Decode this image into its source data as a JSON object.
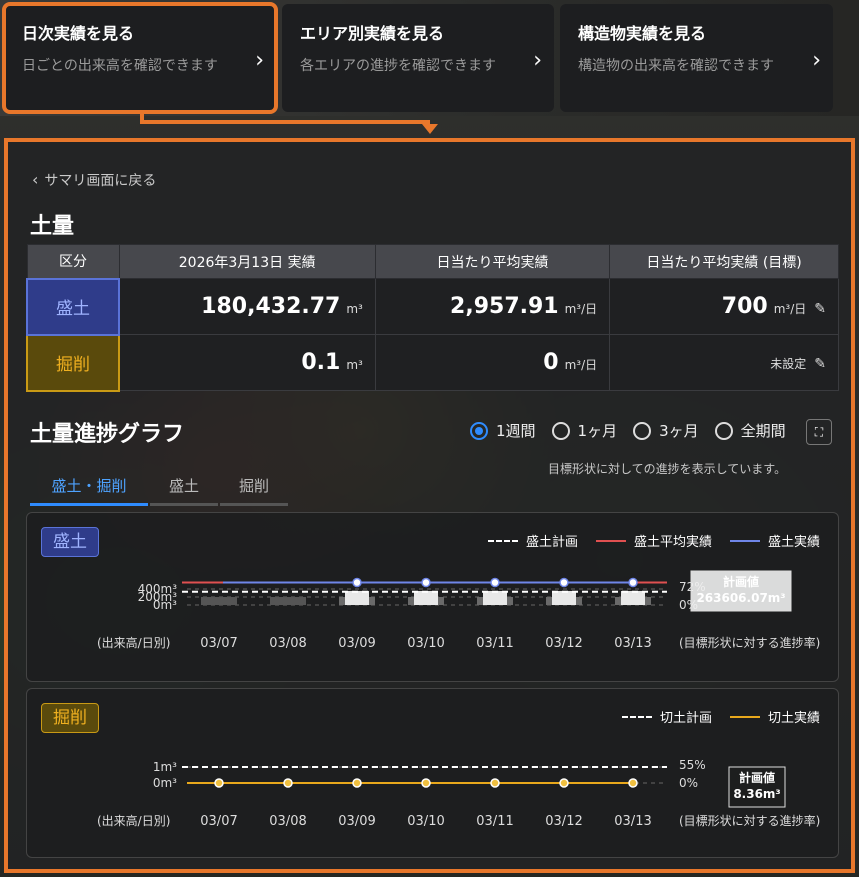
{
  "nav": [
    {
      "title": "日次実績を見る",
      "desc": "日ごとの出来高を確認できます",
      "active": true
    },
    {
      "title": "エリア別実績を見る",
      "desc": "各エリアの進捗を確認できます",
      "active": false
    },
    {
      "title": "構造物実績を見る",
      "desc": "構造物の出来高を確認できます",
      "active": false
    }
  ],
  "back_label": "サマリ画面に戻る",
  "section_title": "土量",
  "table": {
    "headers": [
      "区分",
      "2026年3月13日 実績",
      "日当たり平均実績",
      "日当たり平均実績 (目標)"
    ],
    "rows": [
      {
        "label": "盛土",
        "actual": "180,432.77",
        "actual_unit": "m³",
        "avg": "2,957.91",
        "avg_unit": "m³/日",
        "target": "700",
        "target_unit": "m³/日"
      },
      {
        "label": "掘削",
        "actual": "0.1",
        "actual_unit": "m³",
        "avg": "0",
        "avg_unit": "m³/日",
        "target": "未設定",
        "target_unit": ""
      }
    ]
  },
  "graph_title": "土量進捗グラフ",
  "periods": [
    "1週間",
    "1ヶ月",
    "3ヶ月",
    "全期間"
  ],
  "selected_period": "1週間",
  "graph_note": "目標形状に対しての進捗を表示しています。",
  "tabs": [
    "盛土・掘削",
    "盛土",
    "掘削"
  ],
  "active_tab": "盛土・掘削",
  "chart_data": [
    {
      "type": "line",
      "title": "盛土",
      "x": [
        "03/07",
        "03/08",
        "03/09",
        "03/10",
        "03/11",
        "03/12",
        "03/13"
      ],
      "series": [
        {
          "name": "盛土計画",
          "values": [
            45,
            45,
            45,
            45,
            45,
            45,
            45
          ]
        },
        {
          "name": "盛土平均実績",
          "values": [
            72,
            72,
            72,
            72,
            72,
            72,
            72
          ]
        },
        {
          "name": "盛土実績",
          "values": [
            null,
            null,
            72,
            72,
            72,
            72,
            72
          ]
        }
      ],
      "y_ticks": [
        "400m³",
        "200m³",
        "0m³"
      ],
      "right_ticks": [
        "72%",
        "0%"
      ],
      "xlabel_left": "(出来高/日別)",
      "xlabel_right": "(目標形状に対する進捗率)",
      "plan_label": "計画値",
      "plan_value": "263606.07m³"
    },
    {
      "type": "line",
      "title": "掘削",
      "x": [
        "03/07",
        "03/08",
        "03/09",
        "03/10",
        "03/11",
        "03/12",
        "03/13"
      ],
      "series": [
        {
          "name": "切土計画",
          "values": [
            1,
            1,
            1,
            1,
            1,
            1,
            1
          ]
        },
        {
          "name": "切土実績",
          "values": [
            0,
            0,
            0,
            0,
            0,
            0,
            0
          ]
        }
      ],
      "y_ticks": [
        "1m³",
        "0m³"
      ],
      "right_ticks": [
        "55%",
        "0%"
      ],
      "xlabel_left": "(出来高/日別)",
      "xlabel_right": "(目標形状に対する進捗率)",
      "plan_label": "計画値",
      "plan_value": "8.36m³"
    }
  ],
  "colors": {
    "accent": "#e8772b",
    "mori": "#6f86e8",
    "mori_avg": "#e05050",
    "kussaku": "#e8a81c",
    "selected": "#2f8cff"
  }
}
